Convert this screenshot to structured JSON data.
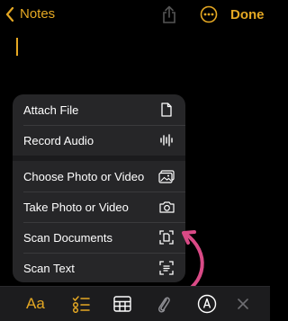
{
  "nav": {
    "back_label": "Notes",
    "done_label": "Done"
  },
  "menu": {
    "attach_file": "Attach File",
    "record_audio": "Record Audio",
    "choose_photo": "Choose Photo or Video",
    "take_photo": "Take Photo or Video",
    "scan_documents": "Scan Documents",
    "scan_text": "Scan Text"
  },
  "toolbar": {
    "format_label": "Aa"
  },
  "colors": {
    "accent": "#e5a823",
    "arrow": "#d94a86",
    "menu_bg": "#262628",
    "toolbar_bg": "#1c1c1e"
  }
}
